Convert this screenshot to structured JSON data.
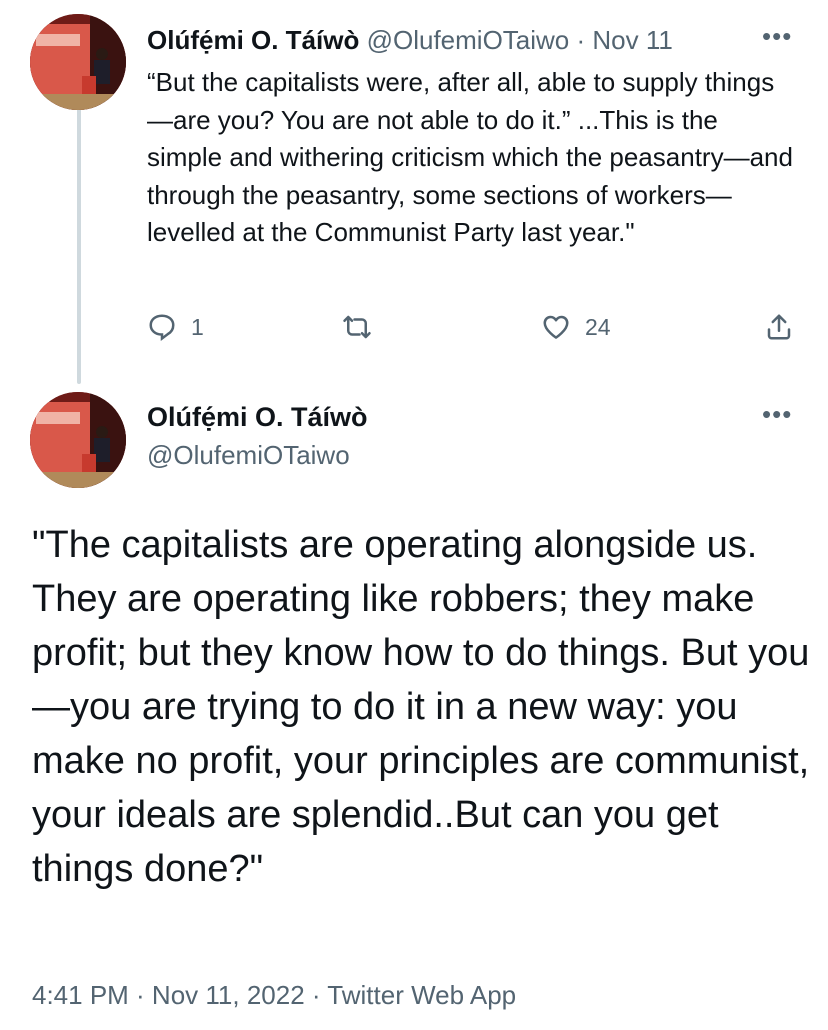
{
  "tweet1": {
    "author_name": "Olúfẹ́mi O. Táíwò",
    "handle": "@OlufemiOTaiwo",
    "separator": "·",
    "date": "Nov 11",
    "more_icon": "more-horizontal-icon",
    "text": "“But the capitalists were, after all, able to supply things—are you? You are not able to do it.” ...This is the simple and withering criticism which the peasantry—and through the peasantry, some sections of workers—levelled at the Communist Party last year.\"",
    "reply_count": "1",
    "retweet_count": "",
    "like_count": "24"
  },
  "tweet2": {
    "author_name": "Olúfẹ́mi O. Táíwò",
    "handle": "@OlufemiOTaiwo",
    "more_icon": "more-horizontal-icon",
    "text": "\"The capitalists are operating alongside us. They are operating like robbers; they make profit; but they know how to do things. But you—you are trying to do it in a new way: you make no profit, your principles are communist, your ideals are splendid..But can you get things done?\"",
    "meta": "4:41 PM · Nov 11, 2022 · Twitter Web App"
  },
  "colors": {
    "text": "#0f1419",
    "muted": "#536471",
    "thread_line": "#cfd9de"
  }
}
